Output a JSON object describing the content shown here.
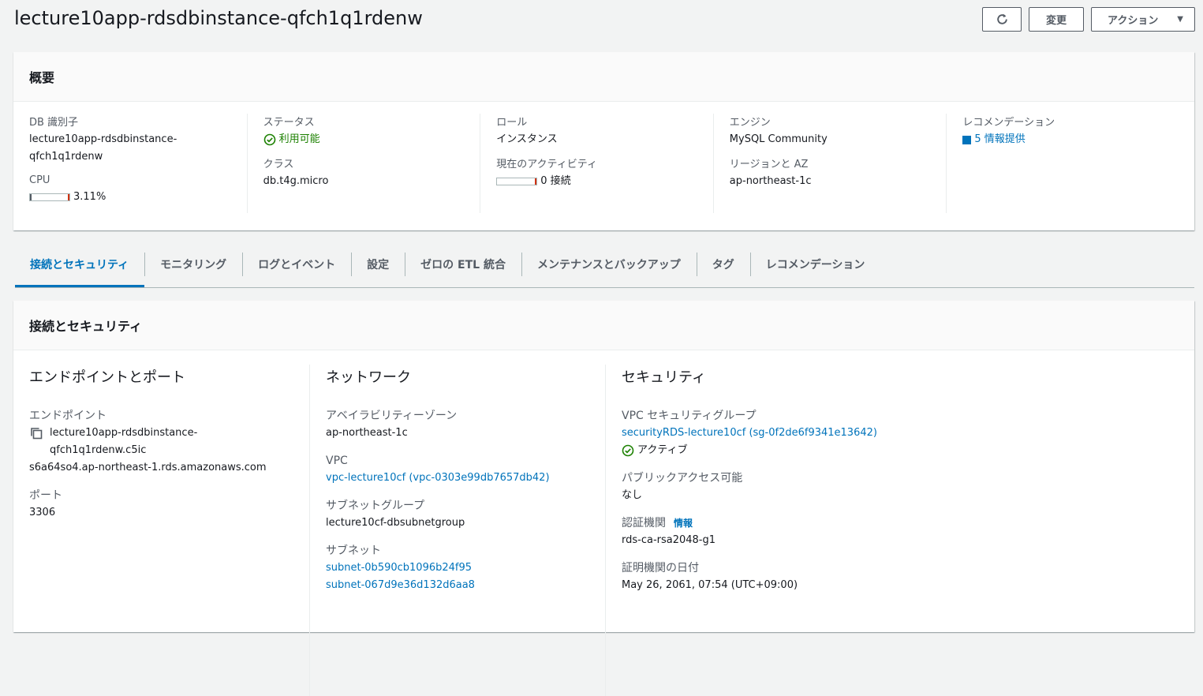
{
  "header": {
    "title": "lecture10app-rdsdbinstance-qfch1q1rdenw",
    "refresh_icon": "refresh-icon",
    "modify_label": "変更",
    "actions_label": "アクション",
    "actions_caret": "▼"
  },
  "summary": {
    "title": "概要",
    "db_identifier_label": "DB 識別子",
    "db_identifier_line1": "lecture10app-rdsdbinstance-",
    "db_identifier_line2": "qfch1q1rdenw",
    "cpu_label": "CPU",
    "cpu_value": "3.11%",
    "cpu_fraction": 0.0311,
    "status_label": "ステータス",
    "status_value": "利用可能",
    "class_label": "クラス",
    "class_value": "db.t4g.micro",
    "role_label": "ロール",
    "role_value": "インスタンス",
    "activity_label": "現在のアクティビティ",
    "activity_value": "0 接続",
    "engine_label": "エンジン",
    "engine_value": "MySQL Community",
    "region_label": "リージョンと AZ",
    "region_value": "ap-northeast-1c",
    "recommend_label": "レコメンデーション",
    "recommend_value": "5 情報提供"
  },
  "tabs": [
    {
      "label": "接続とセキュリティ",
      "active": true
    },
    {
      "label": "モニタリング",
      "active": false
    },
    {
      "label": "ログとイベント",
      "active": false
    },
    {
      "label": "設定",
      "active": false
    },
    {
      "label": "ゼロの ETL 統合",
      "active": false
    },
    {
      "label": "メンテナンスとバックアップ",
      "active": false
    },
    {
      "label": "タグ",
      "active": false
    },
    {
      "label": "レコメンデーション",
      "active": false
    }
  ],
  "connectivity": {
    "title": "接続とセキュリティ",
    "endpoint_section": "エンドポイントとポート",
    "endpoint_label": "エンドポイント",
    "endpoint_line1": "lecture10app-rdsdbinstance-qfch1q1rdenw.c5ic",
    "endpoint_line2": "s6a64so4.ap-northeast-1.rds.amazonaws.com",
    "port_label": "ポート",
    "port_value": "3306",
    "network_section": "ネットワーク",
    "az_label": "アベイラビリティーゾーン",
    "az_value": "ap-northeast-1c",
    "vpc_label": "VPC",
    "vpc_value": "vpc-lecture10cf (vpc-0303e99db7657db42)",
    "subnet_group_label": "サブネットグループ",
    "subnet_group_value": "lecture10cf-dbsubnetgroup",
    "subnets_label": "サブネット",
    "subnet_1": "subnet-0b590cb1096b24f95",
    "subnet_2": "subnet-067d9e36d132d6aa8",
    "security_section": "セキュリティ",
    "sg_label": "VPC セキュリティグループ",
    "sg_value": "securityRDS-lecture10cf (sg-0f2de6f9341e13642)",
    "sg_status": "アクティブ",
    "public_label": "パブリックアクセス可能",
    "public_value": "なし",
    "ca_label": "認証機関",
    "ca_info": "情報",
    "ca_value": "rds-ca-rsa2048-g1",
    "ca_date_label": "証明機関の日付",
    "ca_date_value": "May 26, 2061, 07:54 (UTC+09:00)"
  },
  "colors": {
    "link": "#0073bb",
    "success": "#1d8102",
    "text": "#16191f",
    "label": "#545b64"
  }
}
